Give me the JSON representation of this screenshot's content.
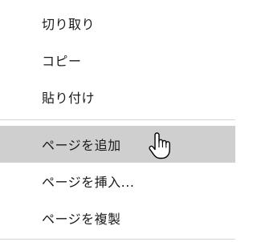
{
  "menu": {
    "items": [
      {
        "label": "切り取り"
      },
      {
        "label": "コピー"
      },
      {
        "label": "貼り付け"
      },
      {
        "label": "ページを追加"
      },
      {
        "label": "ページを挿入..."
      },
      {
        "label": "ページを複製"
      }
    ],
    "hover_color": "#cfcfcf",
    "cursor_icon": "hand-pointer-icon"
  }
}
